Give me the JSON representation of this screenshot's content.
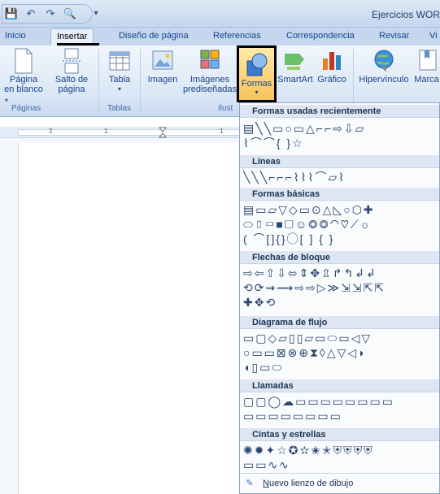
{
  "window": {
    "title": "Ejercicios WOR"
  },
  "quick_access": {
    "save": "💾",
    "undo": "↶",
    "redo": "↷",
    "preview": "🔍",
    "more": "▾"
  },
  "tabs": [
    "Inicio",
    "Insertar",
    "Diseño de página",
    "Referencias",
    "Correspondencia",
    "Revisar",
    "Vi"
  ],
  "ribbon": {
    "groups": {
      "paginas": "Páginas",
      "tablas": "Tablas",
      "ilustraciones": "Ilust"
    },
    "buttons": {
      "pagina_en_blanco_1": "Página",
      "pagina_en_blanco_2": "en blanco",
      "salto_1": "Salto de",
      "salto_2": "página",
      "paginas_arrow": "▾",
      "tabla": "Tabla",
      "tabla_arrow": "▾",
      "imagen": "Imagen",
      "imagenes_1": "Imágenes",
      "imagenes_2": "prediseñadas",
      "formas": "Formas",
      "formas_arrow": "▾",
      "smartart": "SmartArt",
      "grafico": "Gráfico",
      "hipervinculo": "Hipervínculo",
      "marcador": "Marca"
    }
  },
  "ruler": {
    "labels": [
      "2",
      "1",
      "1"
    ]
  },
  "shapes_menu": {
    "sections": [
      {
        "title": "Formas usadas recientemente",
        "rows": [
          "▤╲╲▭○▭△⌐⌐⇨⇩▱",
          "⌇⌒⌒{ }☆"
        ]
      },
      {
        "title": "Líneas",
        "rows": [
          "╲╲╲⌐⌐⌐⌇⌇⌇⌒▱⌇"
        ]
      },
      {
        "title": "Formas básicas",
        "rows": [
          "▤▭▱▽◇▭⊙△◺○⬡✚",
          "⬭▯▭■▢☺◎◎◠♡⟋☼",
          "( ⌒[]{}◯[ ] { }"
        ]
      },
      {
        "title": "Flechas de bloque",
        "rows": [
          "⇨⇦⇧⇩⬄⇕✥⇫↱↰↲↲",
          "⟲⟳⇝⟿⇨⇨▷≫⇲⇲⇱⇱",
          "✚✥⟲"
        ]
      },
      {
        "title": "Diagrama de flujo",
        "rows": [
          "▭▢◇▱▯▯▱▭⬭▭◁▽",
          "○▭▭⊠⊗⊕⧗◊△▽◁◗",
          "◖▯▭⬭"
        ]
      },
      {
        "title": "Llamadas",
        "rows": [
          "▢▢◯☁▭▭▭▭▭▭▭▭",
          "▭▭▭▭▭▭▭▭"
        ]
      },
      {
        "title": "Cintas y estrellas",
        "rows": [
          "✺✹✦☆✪✫✬✭⛨⛨⛨⛨",
          "▭▭∿∿"
        ]
      }
    ],
    "footer": {
      "prefix": "N",
      "rest": "uevo lienzo de dibujo",
      "icon": "✎"
    }
  }
}
